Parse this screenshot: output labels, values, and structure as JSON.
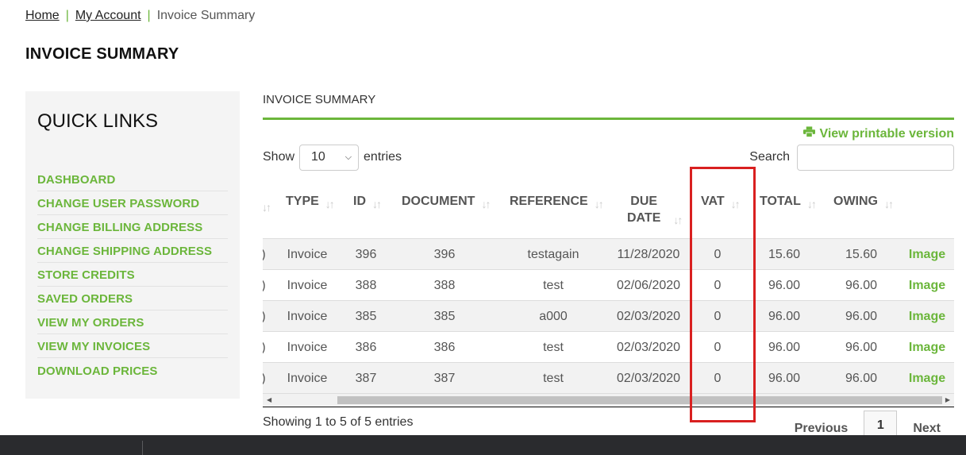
{
  "breadcrumb": {
    "home": "Home",
    "account": "My Account",
    "current": "Invoice Summary",
    "separator": "|"
  },
  "page_title": "INVOICE SUMMARY",
  "sidebar": {
    "title": "QUICK LINKS",
    "items": [
      {
        "label": "DASHBOARD"
      },
      {
        "label": "CHANGE USER PASSWORD"
      },
      {
        "label": "CHANGE BILLING ADDRESS"
      },
      {
        "label": "CHANGE SHIPPING ADDRESS"
      },
      {
        "label": "STORE CREDITS"
      },
      {
        "label": "SAVED ORDERS"
      },
      {
        "label": "VIEW MY ORDERS"
      },
      {
        "label": "VIEW MY INVOICES"
      },
      {
        "label": "DOWNLOAD PRICES"
      }
    ]
  },
  "main": {
    "section_title": "INVOICE SUMMARY",
    "printable_label": "View printable version",
    "printable_icon": "printer-icon",
    "show_label": "Show",
    "entries_label": "entries",
    "page_size": "10",
    "search_label": "Search",
    "search_value": "",
    "columns": {
      "type": "TYPE",
      "id": "ID",
      "document": "DOCUMENT",
      "reference": "REFERENCE",
      "due_date_1": "DUE",
      "due_date_2": "DATE",
      "vat": "VAT",
      "total": "TOTAL",
      "owing": "OWING"
    },
    "rows": [
      {
        "partial": ")",
        "type": "Invoice",
        "id": "396",
        "document": "396",
        "reference": "testagain",
        "due_date": "11/28/2020",
        "vat": "0",
        "total": "15.60",
        "owing": "15.60",
        "action": "Image"
      },
      {
        "partial": ")",
        "type": "Invoice",
        "id": "388",
        "document": "388",
        "reference": "test",
        "due_date": "02/06/2020",
        "vat": "0",
        "total": "96.00",
        "owing": "96.00",
        "action": "Image"
      },
      {
        "partial": ")",
        "type": "Invoice",
        "id": "385",
        "document": "385",
        "reference": "a000",
        "due_date": "02/03/2020",
        "vat": "0",
        "total": "96.00",
        "owing": "96.00",
        "action": "Image"
      },
      {
        "partial": ")",
        "type": "Invoice",
        "id": "386",
        "document": "386",
        "reference": "test",
        "due_date": "02/03/2020",
        "vat": "0",
        "total": "96.00",
        "owing": "96.00",
        "action": "Image"
      },
      {
        "partial": ")",
        "type": "Invoice",
        "id": "387",
        "document": "387",
        "reference": "test",
        "due_date": "02/03/2020",
        "vat": "0",
        "total": "96.00",
        "owing": "96.00",
        "action": "Image"
      }
    ],
    "info": "Showing 1 to 5 of 5 entries",
    "pager": {
      "previous": "Previous",
      "current_page": "1",
      "next": "Next"
    }
  },
  "colors": {
    "accent": "#6bb63b",
    "highlight": "#d92020",
    "taskbar": "#2a2b2e"
  }
}
